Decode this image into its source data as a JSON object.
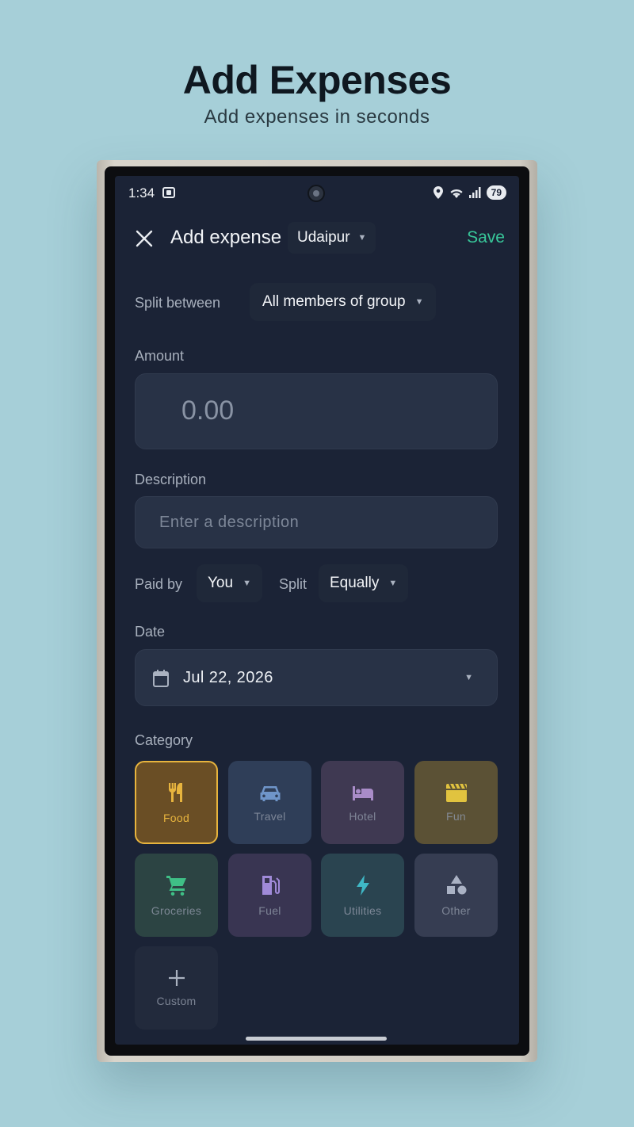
{
  "promo": {
    "title": "Add Expenses",
    "subtitle": "Add expenses in seconds"
  },
  "status_bar": {
    "time": "1:34",
    "battery": "79",
    "icons": [
      "screen-record-icon",
      "location-icon",
      "wifi-icon",
      "signal-icon",
      "battery-icon"
    ]
  },
  "top_bar": {
    "title": "Add expense",
    "group": "Udaipur",
    "save_label": "Save"
  },
  "split_between": {
    "label": "Split between",
    "value": "All members of group"
  },
  "amount": {
    "label": "Amount",
    "placeholder": "0.00"
  },
  "description": {
    "label": "Description",
    "placeholder": "Enter a description"
  },
  "paid_by": {
    "label": "Paid by",
    "value": "You"
  },
  "split": {
    "label": "Split",
    "value": "Equally"
  },
  "date": {
    "label": "Date",
    "value": "Jul 22, 2026"
  },
  "category": {
    "label": "Category",
    "selected": "Food",
    "items": [
      {
        "label": "Food",
        "icon": "fork-knife-icon",
        "fg": "#e7b43e",
        "bg": "#6a4e25",
        "selected": true
      },
      {
        "label": "Travel",
        "icon": "car-icon",
        "fg": "#6f95c9",
        "bg": "#2f3e58"
      },
      {
        "label": "Hotel",
        "icon": "bed-icon",
        "fg": "#a98cc8",
        "bg": "#3f3952"
      },
      {
        "label": "Fun",
        "icon": "clapperboard-icon",
        "fg": "#e1c33f",
        "bg": "#5b5135"
      },
      {
        "label": "Groceries",
        "icon": "cart-icon",
        "fg": "#3fbf86",
        "bg": "#2c4443"
      },
      {
        "label": "Fuel",
        "icon": "fuel-pump-icon",
        "fg": "#a08ad8",
        "bg": "#393552"
      },
      {
        "label": "Utilities",
        "icon": "bolt-icon",
        "fg": "#3fb8c6",
        "bg": "#2a4450"
      },
      {
        "label": "Other",
        "icon": "shapes-icon",
        "fg": "#aab2c4",
        "bg": "#363d52"
      },
      {
        "label": "Custom",
        "icon": "plus-icon",
        "fg": "#aab2c0",
        "bg": "#222a3c"
      }
    ]
  }
}
